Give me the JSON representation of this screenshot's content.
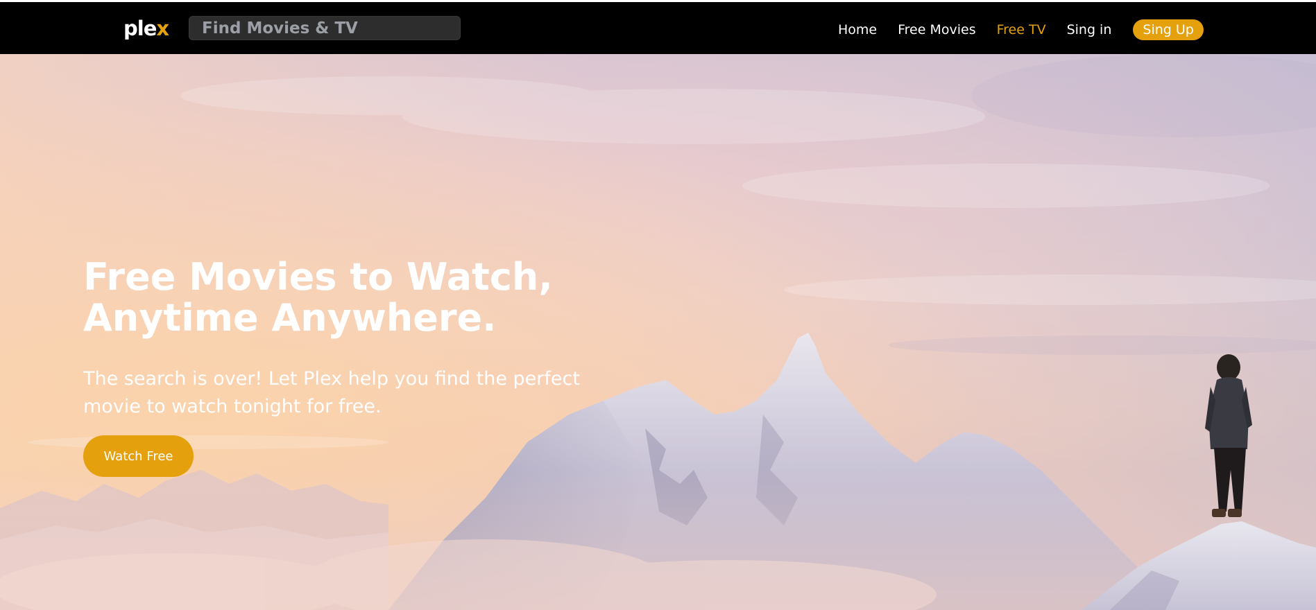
{
  "brand": {
    "logo_main": "ple",
    "logo_accent": "x",
    "accent_color": "#e5a00d"
  },
  "search": {
    "placeholder": "Find Movies & TV"
  },
  "nav": {
    "home": "Home",
    "free_movies": "Free Movies",
    "free_tv": "Free TV",
    "sign_in": "Sing in",
    "sign_up": "Sing Up",
    "active_item": "Free TV"
  },
  "hero": {
    "title": "Free Movies to Watch, Anytime Anywhere.",
    "subtitle": "The search is over! Let Plex help you find the perfect movie to watch tonight for free.",
    "cta_label": "Watch Free",
    "background_image": "snowy mountain peaks at sunset with a hiker standing on a summit"
  }
}
